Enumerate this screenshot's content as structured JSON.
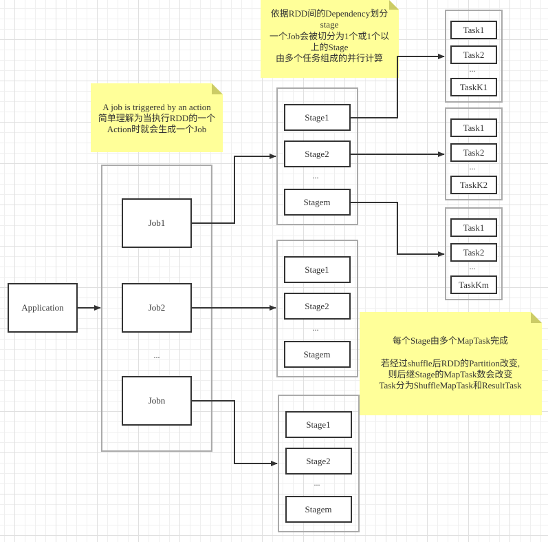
{
  "colors": {
    "note_fill": "#ffff99",
    "note_fold": "#cccc66",
    "box_stroke": "#333333",
    "group_stroke": "#aaaaaa",
    "text": "#333333"
  },
  "application": {
    "label": "Application"
  },
  "jobs": {
    "items": [
      "Job1",
      "Job2",
      "Jobn"
    ],
    "ellipsis": "..."
  },
  "stage_groups": [
    {
      "stages": [
        "Stage1",
        "Stage2",
        "Stagem"
      ],
      "ellipsis": "..."
    },
    {
      "stages": [
        "Stage1",
        "Stage2",
        "Stagem"
      ],
      "ellipsis": "..."
    },
    {
      "stages": [
        "Stage1",
        "Stage2",
        "Stagem"
      ],
      "ellipsis": "..."
    }
  ],
  "task_groups": [
    {
      "tasks": [
        "Task1",
        "Task2",
        "TaskK1"
      ],
      "ellipsis": "..."
    },
    {
      "tasks": [
        "Task1",
        "Task2",
        "TaskK2"
      ],
      "ellipsis": "..."
    },
    {
      "tasks": [
        "Task1",
        "Task2",
        "TaskKm"
      ],
      "ellipsis": "..."
    }
  ],
  "notes": {
    "job_note": [
      "A job is triggered by an action",
      "简单理解为当执行RDD的一个",
      "Action时就会生成一个Job"
    ],
    "stage_note": [
      "依据RDD间的Dependency划分",
      "stage",
      "一个Job会被切分为1个或1个以",
      "上的Stage",
      "由多个任务组成的并行计算"
    ],
    "task_note": [
      "每个Stage由多个MapTask完成",
      "",
      "若经过shuffle后RDD的Partition改变,",
      "则后继Stage的MapTask数会改变",
      "Task分为ShuffleMapTask和ResultTask"
    ]
  }
}
